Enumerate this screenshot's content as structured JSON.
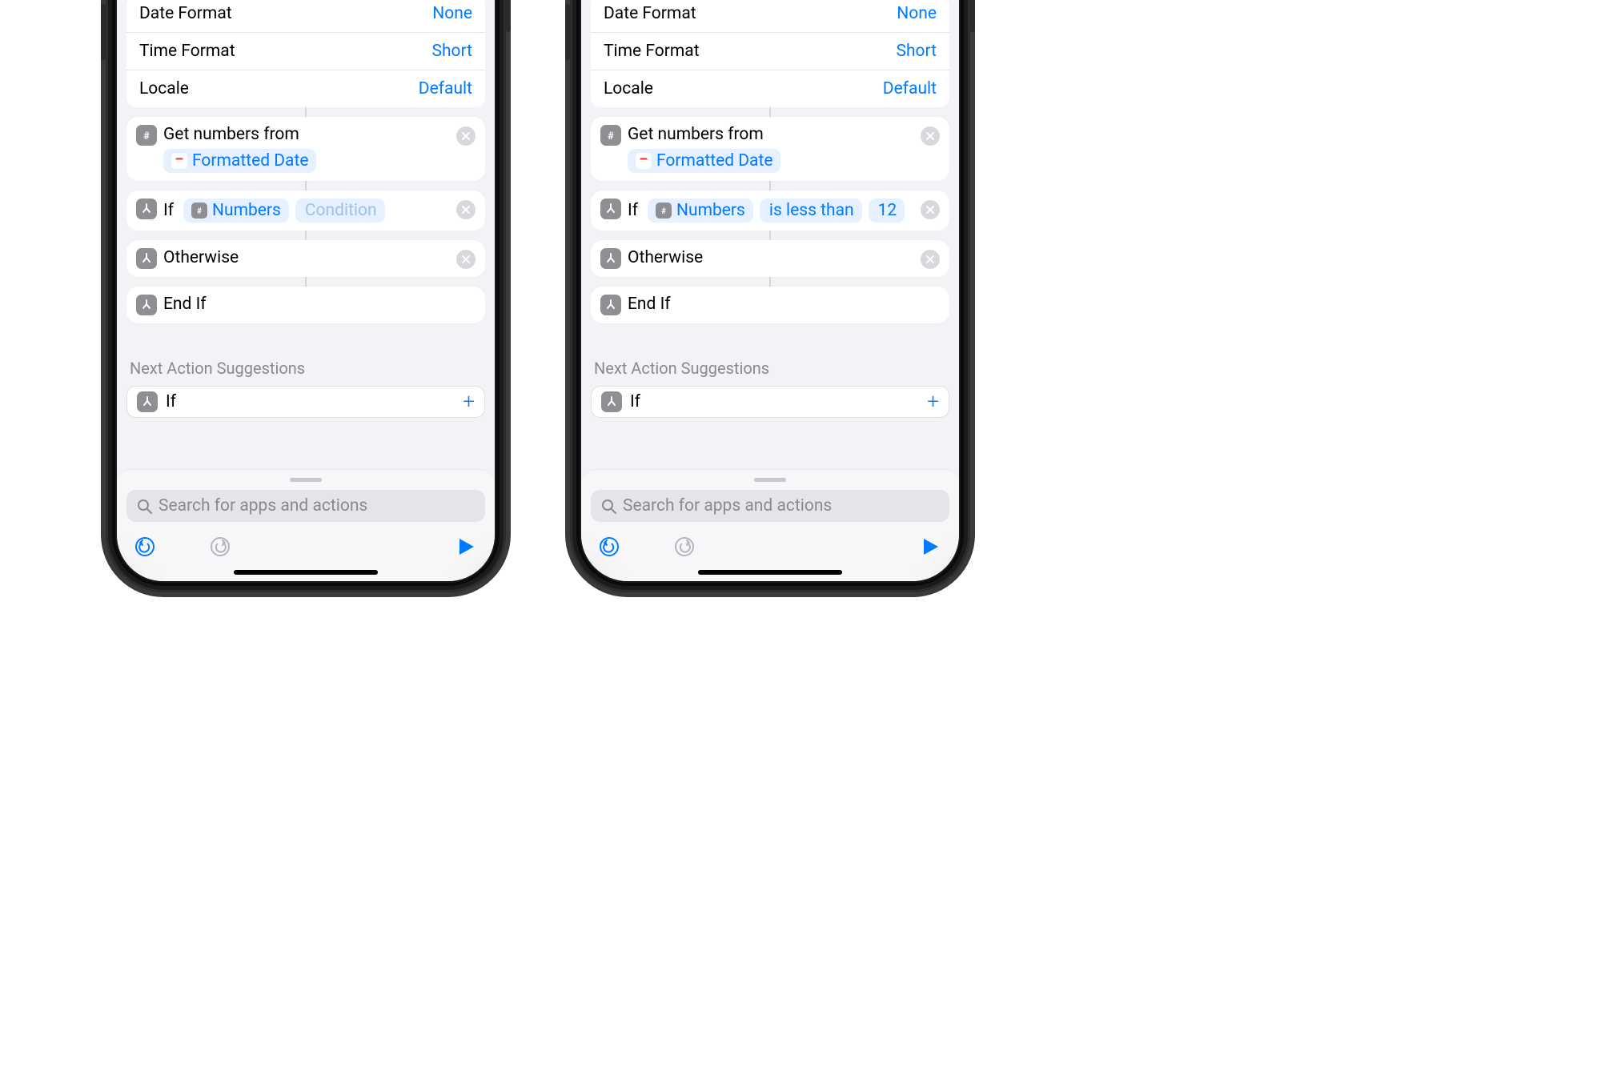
{
  "settings": {
    "date_format": {
      "label": "Date Format",
      "value": "None"
    },
    "time_format": {
      "label": "Time Format",
      "value": "Short"
    },
    "locale": {
      "label": "Locale",
      "value": "Default"
    }
  },
  "actions": {
    "get_numbers": {
      "title": "Get numbers from",
      "input_token": "Formatted Date"
    },
    "if_left": {
      "title": "If",
      "var_token": "Numbers",
      "condition_placeholder": "Condition"
    },
    "if_right": {
      "title": "If",
      "var_token": "Numbers",
      "operator_text": "is less than",
      "value_text": "12"
    },
    "otherwise": {
      "title": "Otherwise"
    },
    "end_if": {
      "title": "End If"
    }
  },
  "suggestions": {
    "header": "Next Action Suggestions",
    "items": [
      {
        "label": "If"
      }
    ]
  },
  "search": {
    "placeholder": "Search for apps and actions"
  }
}
